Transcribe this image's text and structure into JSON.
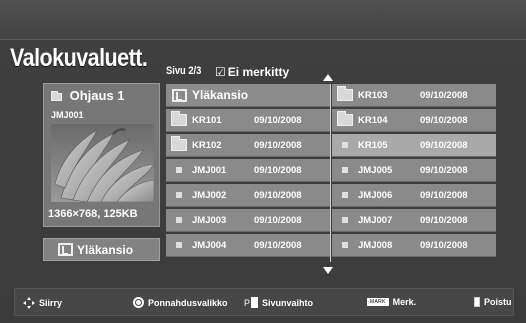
{
  "header": {
    "title": "Valokuvaluett.",
    "page_indicator": "Sivu 2/3",
    "mark_indicator": "Ei merkitty",
    "mark_checkbox_glyph": "☑"
  },
  "preview": {
    "folder_name": "Ohjaus 1",
    "file_name": "JMJ001",
    "resolution": "1366×768, 125KB",
    "folder_icon": "folder-open-icon"
  },
  "up_button": {
    "label": "Yläkansio",
    "icon": "up-folder-icon"
  },
  "list": {
    "left_column": [
      {
        "type": "up",
        "name": "Yläkansio",
        "date": ""
      },
      {
        "type": "folder",
        "name": "KR101",
        "date": "09/10/2008"
      },
      {
        "type": "folder",
        "name": "KR102",
        "date": "09/10/2008"
      },
      {
        "type": "file",
        "name": "JMJ001",
        "date": "09/10/2008"
      },
      {
        "type": "file",
        "name": "JMJ002",
        "date": "09/10/2008"
      },
      {
        "type": "file",
        "name": "JMJ003",
        "date": "09/10/2008"
      },
      {
        "type": "file",
        "name": "JMJ004",
        "date": "09/10/2008"
      }
    ],
    "right_column": [
      {
        "type": "folder",
        "name": "KR103",
        "date": "09/10/2008"
      },
      {
        "type": "folder",
        "name": "KR104",
        "date": "09/10/2008"
      },
      {
        "type": "file",
        "name": "KR105",
        "date": "09/10/2008",
        "selected": true
      },
      {
        "type": "file",
        "name": "JMJ005",
        "date": "09/10/2008"
      },
      {
        "type": "file",
        "name": "JMJ006",
        "date": "09/10/2008"
      },
      {
        "type": "file",
        "name": "JMJ007",
        "date": "09/10/2008"
      },
      {
        "type": "file",
        "name": "JMJ008",
        "date": "09/10/2008"
      }
    ]
  },
  "bottom_bar": {
    "move_label": "Siirry",
    "popup_label": "Ponnahdusvalikko",
    "page_key": "P",
    "page_label": "Sivunvaihto",
    "mark_key": "MARK",
    "mark_label": "Merk.",
    "exit_label": "Poistu"
  },
  "colors": {
    "background": "#3b3b3b",
    "cell": "#8a8a8a",
    "selected_cell": "#a9a9a9",
    "text": "#ffffff"
  }
}
